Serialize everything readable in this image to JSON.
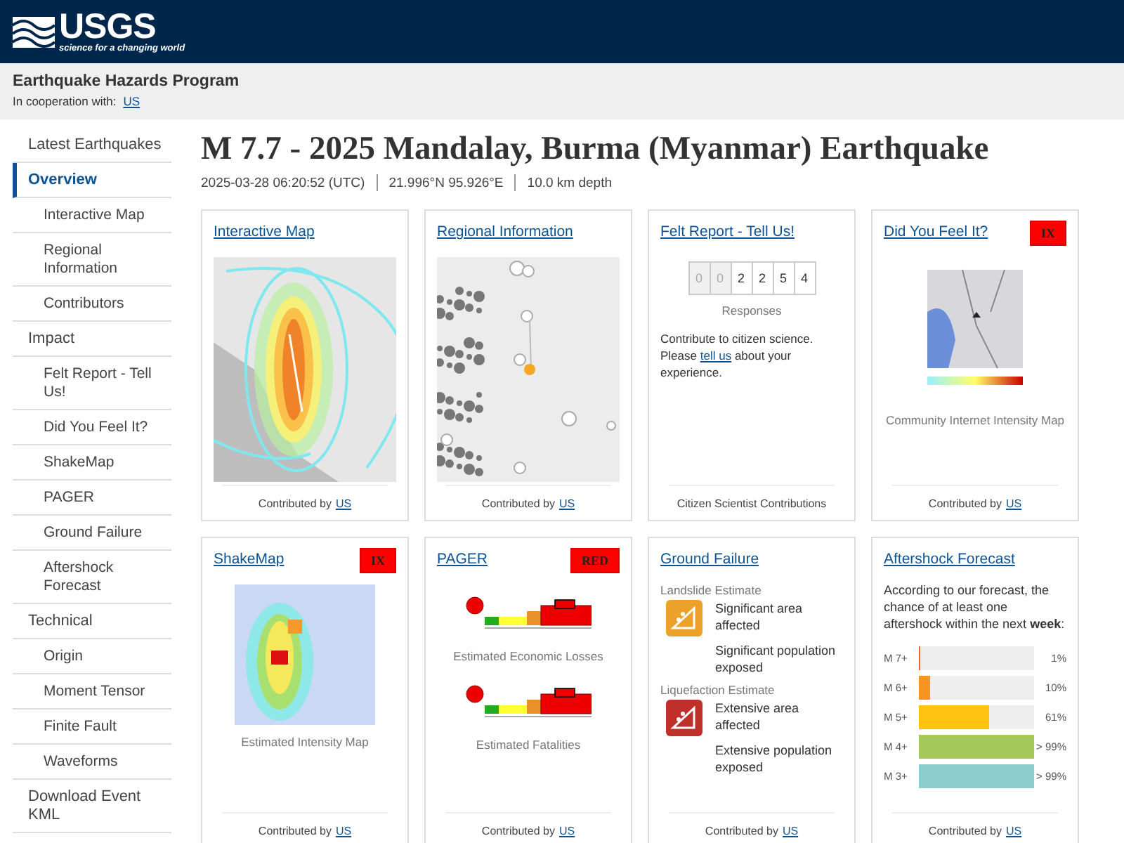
{
  "header": {
    "logo": "USGS",
    "tagline": "science for a changing world"
  },
  "program": {
    "title": "Earthquake Hazards Program",
    "cooperation_label": "In cooperation with:",
    "cooperation_link": "US"
  },
  "sidebar": {
    "items": [
      {
        "label": "Latest Earthquakes",
        "selected": false
      },
      {
        "label": "Overview",
        "selected": true,
        "children": [
          {
            "label": "Interactive Map",
            "selected": false
          },
          {
            "label": "Regional Information",
            "selected": false
          },
          {
            "label": "Contributors",
            "selected": false
          }
        ]
      },
      {
        "label": "Impact",
        "selected": false,
        "children": [
          {
            "label": "Felt Report - Tell Us!",
            "selected": false
          },
          {
            "label": "Did You Feel It?",
            "selected": false
          },
          {
            "label": "ShakeMap",
            "selected": false
          },
          {
            "label": "PAGER",
            "selected": false
          },
          {
            "label": "Ground Failure",
            "selected": false
          },
          {
            "label": "Aftershock Forecast",
            "selected": false
          }
        ]
      },
      {
        "label": "Technical",
        "selected": false,
        "children": [
          {
            "label": "Origin",
            "selected": false
          },
          {
            "label": "Moment Tensor",
            "selected": false
          },
          {
            "label": "Finite Fault",
            "selected": false
          },
          {
            "label": "Waveforms",
            "selected": false
          }
        ]
      },
      {
        "label": "Download Event KML",
        "selected": false
      }
    ]
  },
  "event": {
    "title": "M 7.7 - 2025 Mandalay, Burma (Myanmar) Earthquake",
    "time": "2025-03-28 06:20:52 (UTC)",
    "location": "21.996°N 95.926°E",
    "depth": "10.0 km depth"
  },
  "cards": [
    {
      "kind": "intensity-map",
      "title": "Interactive Map",
      "footer_label": "Contributed by",
      "footer_link": "US"
    },
    {
      "kind": "regional-map",
      "title": "Regional Information",
      "footer_label": "Contributed by",
      "footer_link": "US"
    },
    {
      "kind": "felt",
      "title": "Felt Report - Tell Us!",
      "digits": [
        {
          "value": "0",
          "leading": true
        },
        {
          "value": "0",
          "leading": true
        },
        {
          "value": "2",
          "leading": false
        },
        {
          "value": "2",
          "leading": false
        },
        {
          "value": "5",
          "leading": false
        },
        {
          "value": "4",
          "leading": false
        }
      ],
      "counter_label": "Responses",
      "text_before": "Contribute to citizen science. Please",
      "link": "tell us",
      "text_after": "about your experience.",
      "footer_label": "Citizen Scientist Contributions"
    },
    {
      "kind": "dyfi",
      "title": "Did You Feel It?",
      "badge": "IX",
      "caption": "Community Internet Intensity Map",
      "footer_label": "Contributed by",
      "footer_link": "US"
    },
    {
      "kind": "shakemap",
      "title": "ShakeMap",
      "badge": "IX",
      "caption": "Estimated Intensity Map",
      "footer_label": "Contributed by",
      "footer_link": "US"
    },
    {
      "kind": "pager",
      "title": "PAGER",
      "badge": "RED",
      "captions": [
        "Estimated Economic Losses",
        "Estimated Fatalities"
      ],
      "footer_label": "Contributed by",
      "footer_link": "US"
    },
    {
      "kind": "ground-failure",
      "title": "Ground Failure",
      "sections": [
        {
          "heading": "Landslide Estimate",
          "color": "#eba12a",
          "lines": [
            "Significant area affected",
            "Significant population exposed"
          ]
        },
        {
          "heading": "Liquefaction Estimate",
          "color": "#c0302a",
          "lines": [
            "Extensive area affected",
            "Extensive population exposed"
          ]
        }
      ],
      "footer_label": "Contributed by",
      "footer_link": "US"
    },
    {
      "kind": "aftershock",
      "title": "Aftershock Forecast",
      "intro": "According to our forecast, the chance of at least one aftershock within the next **week**:",
      "rows": [
        {
          "label": "M 7+",
          "level": 0.01,
          "reading": "1%",
          "color": "#f26522"
        },
        {
          "label": "M 6+",
          "level": 0.1,
          "reading": "10%",
          "color": "#f7941d"
        },
        {
          "label": "M 5+",
          "level": 0.61,
          "reading": "61%",
          "color": "#ffc20e"
        },
        {
          "label": "M 4+",
          "level": 1,
          "reading": "> 99%",
          "color": "#a5c85a"
        },
        {
          "label": "M 3+",
          "level": 1,
          "reading": "> 99%",
          "color": "#8ecbcf"
        }
      ],
      "footer_label": "Contributed by",
      "footer_link": "US"
    }
  ]
}
